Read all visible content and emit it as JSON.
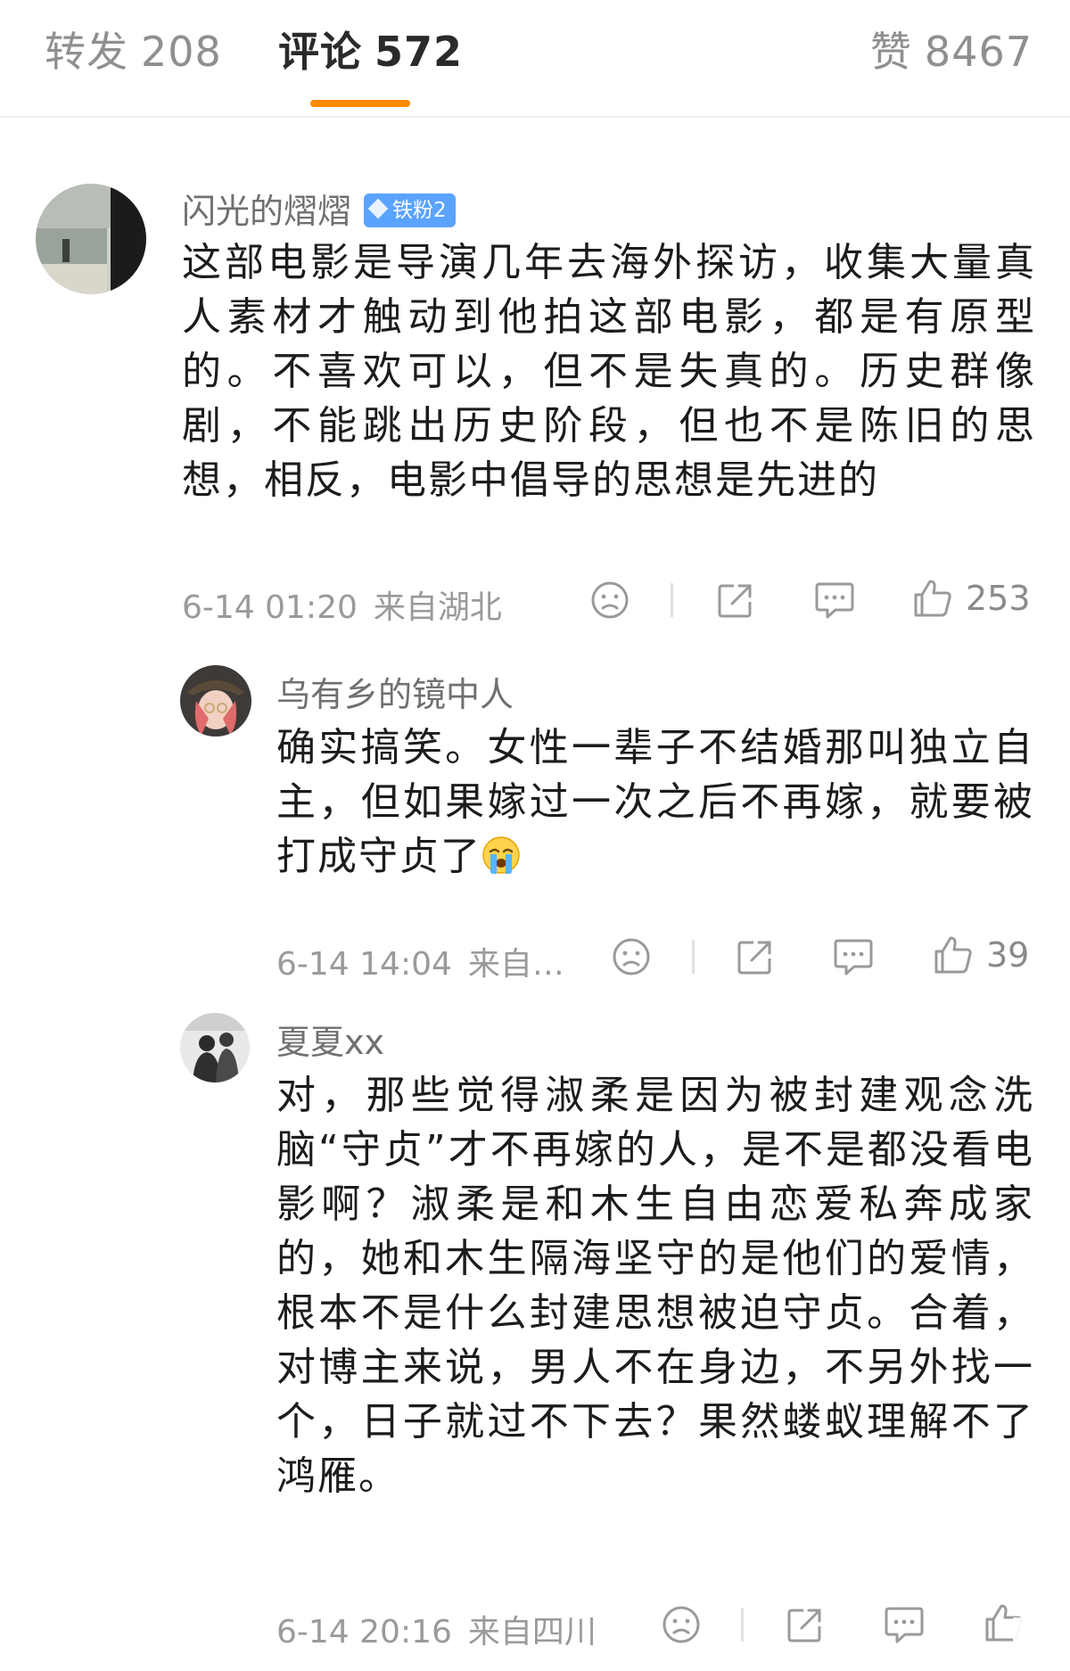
{
  "tabs": {
    "repost": {
      "label": "转发",
      "count": "208"
    },
    "comments": {
      "label": "评论",
      "count": "572"
    },
    "likes": {
      "label": "赞",
      "count": "8467"
    }
  },
  "comments": [
    {
      "username": "闪光的熠熠",
      "badge": "铁粉2",
      "text": "这部电影是导演几年去海外探访，收集大量真人素材才触动到他拍这部电影，都是有原型的。不喜欢可以，但不是失真的。历史群像剧，不能跳出历史阶段，但也不是陈旧的思想，相反，电影中倡导的思想是先进的",
      "time": "6-14 01:20",
      "location": "来自湖北",
      "likes": "253"
    },
    {
      "username": "乌有乡的镜中人",
      "text": "确实搞笑。女性一辈子不结婚那叫独立自主，但如果嫁过一次之后不再嫁，就要被打成守贞了",
      "emoji": "crying-face",
      "time": "6-14 14:04",
      "location": "来自…",
      "likes": "39"
    },
    {
      "username": "夏夏xx",
      "text": "对，那些觉得淑柔是因为被封建观念洗脑“守贞”才不再嫁的人，是不是都没看电影啊？淑柔是和木生自由恋爱私奔成家的，她和木生隔海坚守的是他们的爱情，根本不是什么封建思想被迫守贞。合着，对博主来说，男人不在身边，不另外找一个，日子就过不下去？果然蝼蚁理解不了鸿雁。",
      "time": "6-14 20:16",
      "location": "来自四川"
    }
  ],
  "icons": [
    "face-icon",
    "share-icon",
    "comment-icon",
    "thumb-up-icon"
  ],
  "colors": {
    "accent": "#ff8a00",
    "badge": "#5aa3ff",
    "meta": "#9a9a9a"
  }
}
